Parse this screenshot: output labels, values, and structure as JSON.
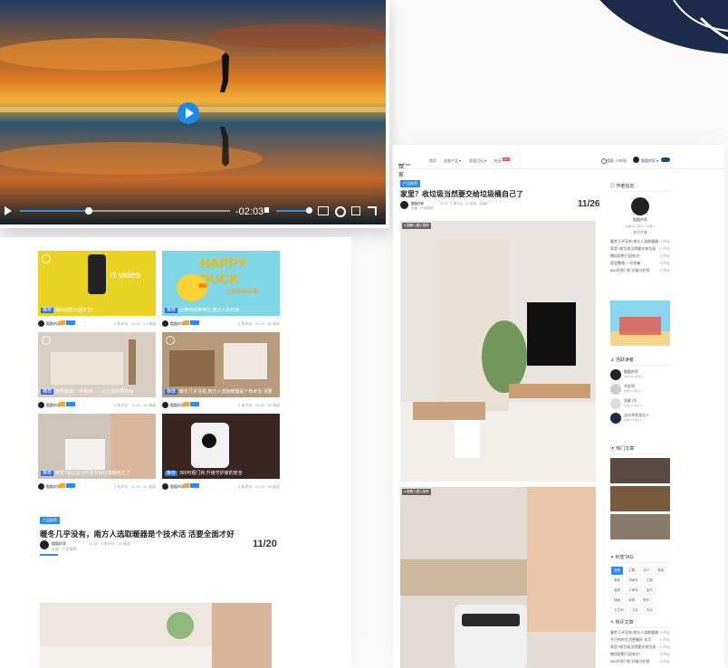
{
  "video": {
    "time": "-02:03",
    "controls": [
      "play",
      "volume",
      "subtitles",
      "settings",
      "popout",
      "fullscreen"
    ]
  },
  "left": {
    "cards": [
      {
        "caption": "捕风捉影只因有它!",
        "stats": "0 条评论 · 11-20 · 14 阅读",
        "name": "酷酷的家",
        "tag": "video-card",
        "img_text": "rt video"
      },
      {
        "caption": "日常用线条呼应,南方人的日常",
        "stats": "0 条评论 · 11-20 · 50 阅读",
        "name": "酷酷的家",
        "img_text": "HAPPY DUCK",
        "img_sub": "主题插画合集"
      },
      {
        "caption": "家居整理:一半纸箱……让它真的更好用",
        "stats": "1 条评论 · 11-20 · 45 阅读",
        "name": "酷酷的家"
      },
      {
        "caption": "暖冬几乎没有,南方人选取暖器是个技术活 活要",
        "stats": "0 条评论 · 11-20 · 39 阅读",
        "name": "酷酷的家"
      },
      {
        "caption": "家里?收垃圾当然要交给垃圾桶自己了",
        "stats": "1 条评论 · 11-20 · 61 阅读",
        "name": "酷酷的家"
      },
      {
        "caption": "360可视门铃,升级守护家的安全",
        "stats": "0 条评论 · 11-16 · 20 阅读",
        "name": "酷酷的家"
      }
    ],
    "article": {
      "category": "产品推荐",
      "title": "暖冬几乎没有，南方人选取暖器是个技术活 活要全面才好",
      "author": "酷酷的家",
      "meta": "11-20 · 0 条评论 · 39 阅读",
      "sub": "全部 · 产品推荐",
      "date": "11/20"
    }
  },
  "right": {
    "nav": {
      "logo": "铭家",
      "logo_en": "HoEme",
      "items": [
        "首页",
        "全部产品 ▾",
        "家居日记 ▾",
        "社区"
      ],
      "hot": "HOT",
      "right": [
        "搜索",
        "小铃铛",
        "酷酷的家 ▾"
      ]
    },
    "article": {
      "category": "产品推荐",
      "title": "家里？收垃圾当然要交给垃圾桶自己了",
      "author": "酷酷的家",
      "meta": "11-20 · 1 条评论 · 61 阅读 · [阅读]",
      "sub": "全部 · 产品推荐",
      "date": "11/26",
      "img_tag": "● 图解入图片推荐"
    },
    "author_box": {
      "title": "作者信息",
      "name": "酷酷的家",
      "stats": "文章 25 | 评论 0 | 点赞 0",
      "follow": "关注作者",
      "posts": [
        {
          "t": "暖冬几乎没有,南方人选取暖器",
          "c": "0 评论"
        },
        {
          "t": "家里?收垃圾当然要交给垃圾",
          "c": "1 评论"
        },
        {
          "t": "捕风捉影只因有它!",
          "c": "0 评论"
        },
        {
          "t": "家居整理:一半纸箱",
          "c": "0 评论"
        },
        {
          "t": "360可视门铃,升级守护家",
          "c": "0 评论"
        }
      ]
    },
    "readers": {
      "title": "活跃读者",
      "list": [
        {
          "n": "酷酷的家",
          "s": "文章 25 | 评论 0"
        },
        {
          "n": "刘亚明",
          "s": "文章 0 | 评论 1"
        },
        {
          "n": "游客1号",
          "s": "文章 0 | 评论 0"
        },
        {
          "n": "设计师家居达人",
          "s": "文章 0 | 评论 0"
        }
      ]
    },
    "hot": {
      "title": "热门文章"
    },
    "tags": {
      "title": "标签TAG",
      "list": [
        "全部",
        "主题",
        "设计",
        "配色",
        "居家",
        "场景化",
        "主题",
        "装修",
        "小家电",
        "加热",
        "插画",
        "家具",
        "配件",
        "卫生间",
        "卫浴",
        "洗浴"
      ]
    },
    "comments": {
      "title": "热评文章",
      "list": [
        {
          "t": "暖冬几乎没有,南方人选取暖器",
          "c": "0 评论"
        },
        {
          "t": "今日你的生活更美好 本月",
          "c": "1 评论"
        },
        {
          "t": "家里?收垃圾当然要交给垃圾",
          "c": "1 评论"
        },
        {
          "t": "捕风捉影只因有它!",
          "c": "0 评论"
        },
        {
          "t": "360可视门铃,升级守护家",
          "c": "0 评论"
        }
      ]
    }
  }
}
